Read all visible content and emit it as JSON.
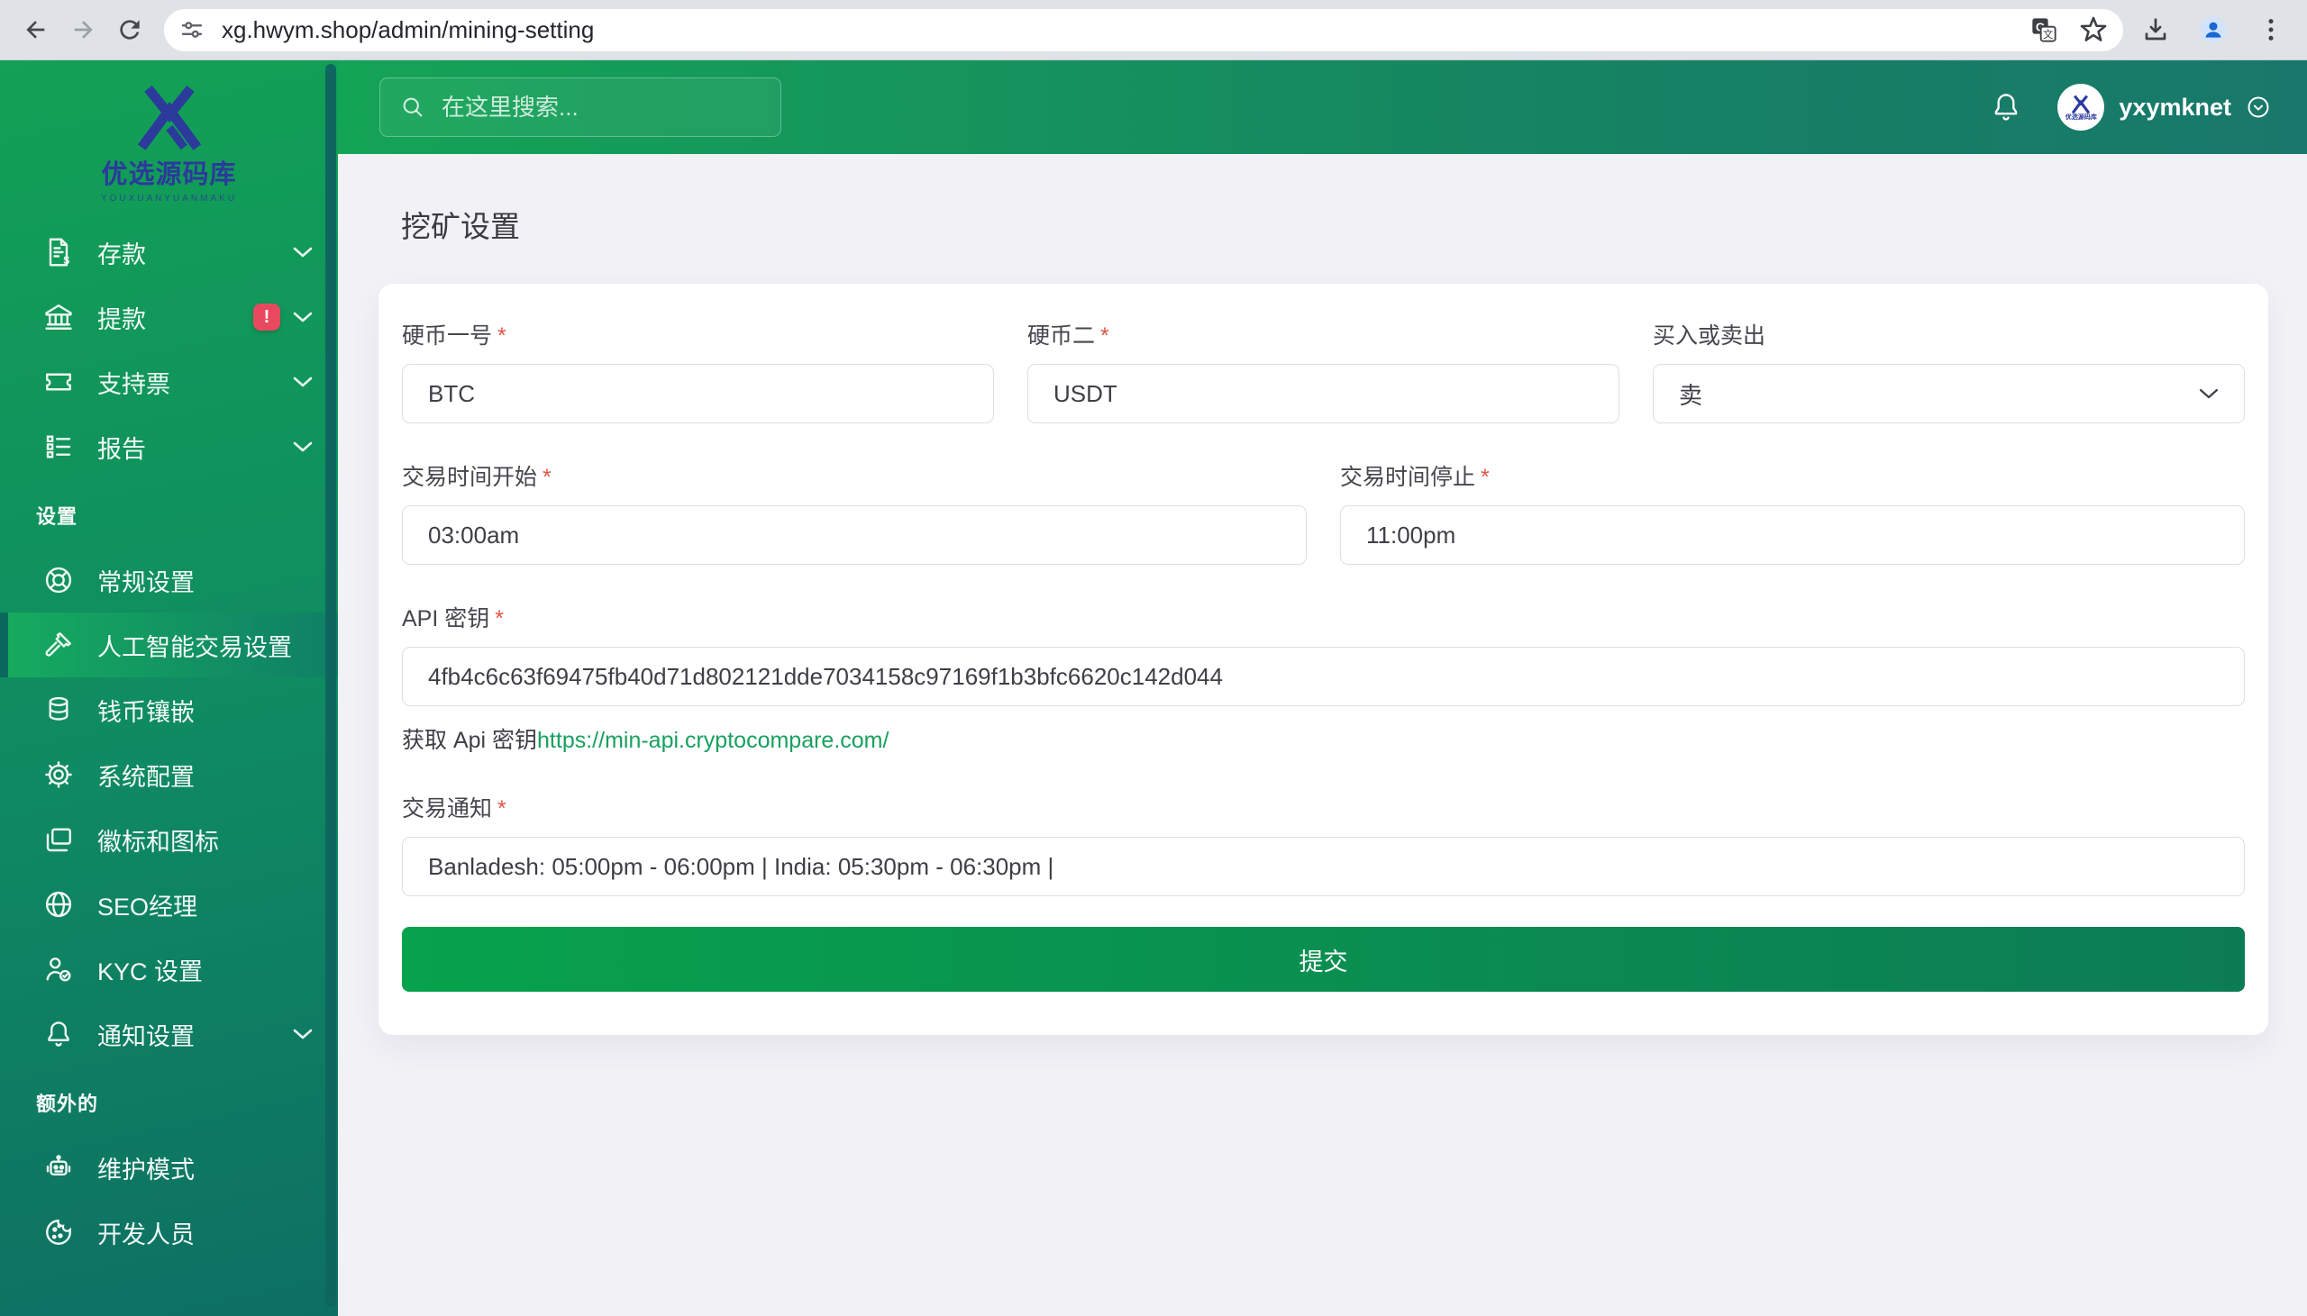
{
  "browser": {
    "url": "xg.hwym.shop/admin/mining-setting"
  },
  "sidebar": {
    "logo": {
      "title": "优选源码库",
      "subtitle": "YOUXUANYUANMAKU"
    },
    "groups": [
      {
        "items": [
          {
            "label": "存款"
          },
          {
            "label": "提款",
            "badge": "!"
          },
          {
            "label": "支持票"
          },
          {
            "label": "报告"
          }
        ]
      },
      {
        "label": "设置",
        "items": [
          {
            "label": "常规设置"
          },
          {
            "label": "人工智能交易设置"
          },
          {
            "label": "钱币镶嵌"
          },
          {
            "label": "系统配置"
          },
          {
            "label": "徽标和图标"
          },
          {
            "label": "SEO经理"
          },
          {
            "label": "KYC 设置"
          },
          {
            "label": "通知设置"
          }
        ]
      },
      {
        "label": "额外的",
        "items": [
          {
            "label": "维护模式"
          },
          {
            "label": "开发人员"
          }
        ]
      }
    ]
  },
  "topbar": {
    "search_placeholder": "在这里搜索...",
    "username": "yxymknet"
  },
  "page": {
    "title": "挖矿设置",
    "form": {
      "required_mark": "*",
      "coin_one": {
        "label": "硬币一号",
        "value": "BTC"
      },
      "coin_two": {
        "label": "硬币二",
        "value": "USDT"
      },
      "buy_or_sell": {
        "label": "买入或卖出",
        "value": "卖"
      },
      "trade_start": {
        "label": "交易时间开始",
        "value": "03:00am"
      },
      "trade_stop": {
        "label": "交易时间停止",
        "value": "11:00pm"
      },
      "api_key": {
        "label": "API 密钥",
        "value": "4fb4c6c63f69475fb40d71d802121dde7034158c97169f1b3bfc6620c142d044",
        "helper_prefix": "获取 Api 密钥",
        "helper_link": "https://min-api.cryptocompare.com/"
      },
      "trade_notice": {
        "label": "交易通知",
        "value": "Banladesh: 05:00pm - 06:00pm | India: 05:30pm - 06:30pm |"
      },
      "submit_label": "提交"
    }
  },
  "colors": {
    "sidebar_green": "#12a155",
    "sidebar_teal": "#0d6f63",
    "active_item": "#16ab5e",
    "badge_red": "#e8495f",
    "link_green": "#18a05f",
    "submit_gradient_start": "#07a24c",
    "submit_gradient_end": "#0c7c55",
    "brand_navy": "#2b3a9b",
    "content_bg": "#f1f1f6"
  }
}
